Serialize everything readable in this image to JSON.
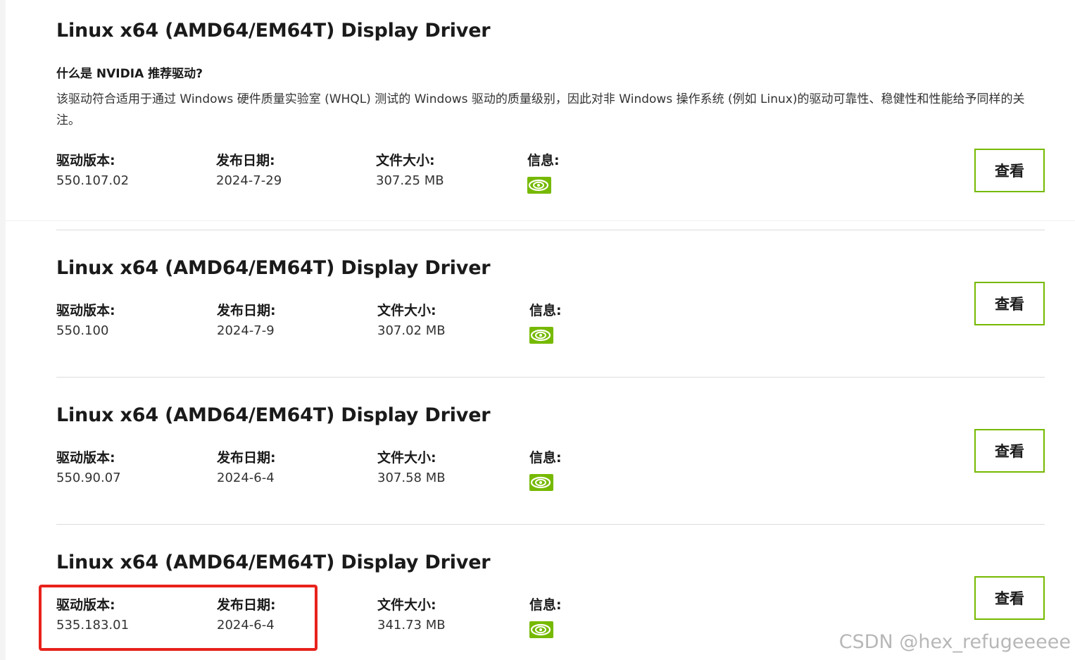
{
  "drivers": [
    {
      "title": "Linux x64 (AMD64/EM64T) Display Driver",
      "question": "什么是 NVIDIA 推荐驱动?",
      "description": "该驱动符合适用于通过 Windows 硬件质量实验室 (WHQL) 测试的 Windows 驱动的质量级别，因此对非 Windows 操作系统 (例如 Linux)的驱动可靠性、稳健性和性能给予同样的关注。",
      "labels": {
        "version": "驱动版本:",
        "date": "发布日期:",
        "size": "文件大小:",
        "info": "信息:"
      },
      "version": "550.107.02",
      "date": "2024-7-29",
      "size": "307.25 MB",
      "info_icon": "nvidia-recommended-icon",
      "button_label": "查看"
    },
    {
      "title": "Linux x64 (AMD64/EM64T) Display Driver",
      "labels": {
        "version": "驱动版本:",
        "date": "发布日期:",
        "size": "文件大小:",
        "info": "信息:"
      },
      "version": "550.100",
      "date": "2024-7-9",
      "size": "307.02 MB",
      "info_icon": "nvidia-recommended-icon",
      "button_label": "查看"
    },
    {
      "title": "Linux x64 (AMD64/EM64T) Display Driver",
      "labels": {
        "version": "驱动版本:",
        "date": "发布日期:",
        "size": "文件大小:",
        "info": "信息:"
      },
      "version": "550.90.07",
      "date": "2024-6-4",
      "size": "307.58 MB",
      "info_icon": "nvidia-recommended-icon",
      "button_label": "查看"
    },
    {
      "title": "Linux x64 (AMD64/EM64T) Display Driver",
      "labels": {
        "version": "驱动版本:",
        "date": "发布日期:",
        "size": "文件大小:",
        "info": "信息:"
      },
      "version": "535.183.01",
      "date": "2024-6-4",
      "size": "341.73 MB",
      "info_icon": "nvidia-recommended-icon",
      "button_label": "查看"
    }
  ],
  "colors": {
    "accent_green": "#76b900",
    "highlight_red": "#e8221c",
    "divider": "#dcdcdc"
  },
  "watermark": "CSDN @hex_refugeeeee"
}
